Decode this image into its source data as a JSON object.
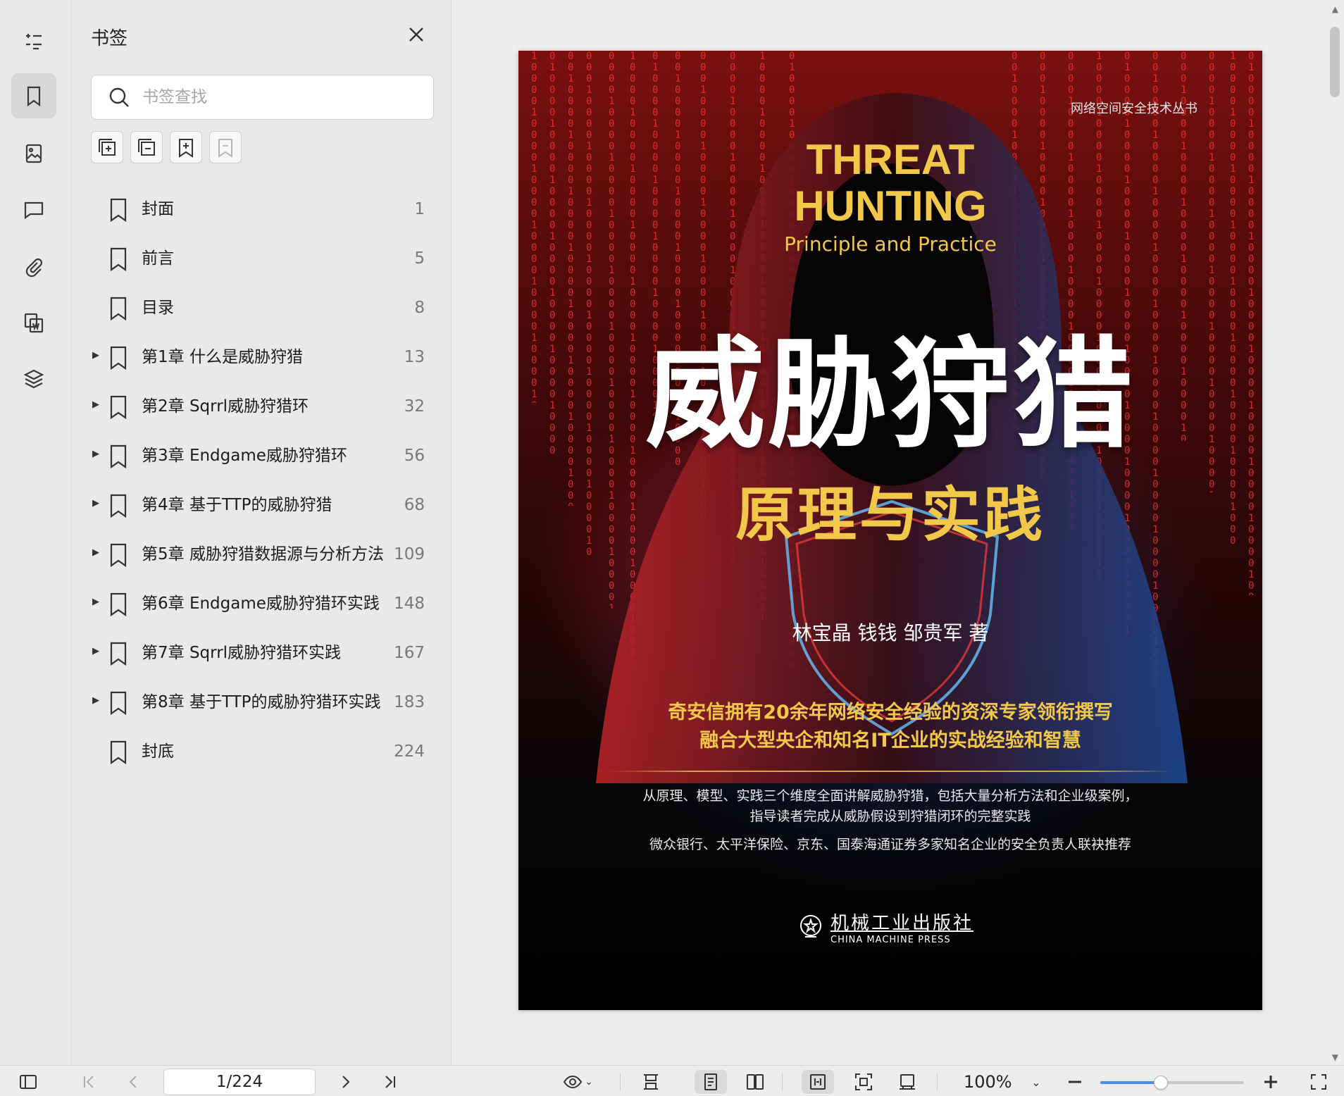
{
  "rail": {
    "items": [
      {
        "name": "outline-icon"
      },
      {
        "name": "bookmark-icon"
      },
      {
        "name": "thumbnail-icon"
      },
      {
        "name": "comment-icon"
      },
      {
        "name": "attachment-icon"
      },
      {
        "name": "extract-icon"
      },
      {
        "name": "layers-icon"
      }
    ]
  },
  "panel": {
    "title": "书签",
    "search_placeholder": "书签查找",
    "bookmarks": [
      {
        "label": "封面",
        "page": "1",
        "expandable": false
      },
      {
        "label": "前言",
        "page": "5",
        "expandable": false
      },
      {
        "label": "目录",
        "page": "8",
        "expandable": false
      },
      {
        "label": "第1章 什么是威胁狩猎",
        "page": "13",
        "expandable": true
      },
      {
        "label": "第2章 Sqrrl威胁狩猎环",
        "page": "32",
        "expandable": true
      },
      {
        "label": "第3章 Endgame威胁狩猎环",
        "page": "56",
        "expandable": true
      },
      {
        "label": "第4章 基于TTP的威胁狩猎",
        "page": "68",
        "expandable": true
      },
      {
        "label": "第5章 威胁狩猎数据源与分析方法",
        "page": "109",
        "expandable": true
      },
      {
        "label": "第6章 Endgame威胁狩猎环实践",
        "page": "148",
        "expandable": true
      },
      {
        "label": "第7章 Sqrrl威胁狩猎环实践",
        "page": "167",
        "expandable": true
      },
      {
        "label": "第8章 基于TTP的威胁狩猎环实践",
        "page": "183",
        "expandable": true
      },
      {
        "label": "封底",
        "page": "224",
        "expandable": false
      }
    ]
  },
  "cover": {
    "series": "网络空间安全技术丛书",
    "en_title_1": "THREAT",
    "en_title_2": "HUNTING",
    "en_subtitle": "Principle and  Practice",
    "cn_title": "威胁狩猎",
    "cn_subtitle": "原理与实践",
    "authors": "林宝晶 钱钱 邹贵军  著",
    "slogan_1": "奇安信拥有20余年网络安全经验的资深专家领衔撰写",
    "slogan_2": "融合大型央企和知名IT企业的实战经验和智慧",
    "desc_1": "从原理、模型、实践三个维度全面讲解威胁狩猎，包括大量分析方法和企业级案例，",
    "desc_2": "指导读者完成从威胁假设到狩猎闭环的完整实践",
    "desc_3": "微众银行、太平洋保险、京东、国泰海通证券多家知名企业的安全负责人联袂推荐",
    "publisher_cn": "机械工业出版社",
    "publisher_en": "CHINA MACHINE PRESS"
  },
  "bottombar": {
    "page_indicator": "1/224",
    "zoom": "100%",
    "zoom_slider_fraction": 0.42
  }
}
